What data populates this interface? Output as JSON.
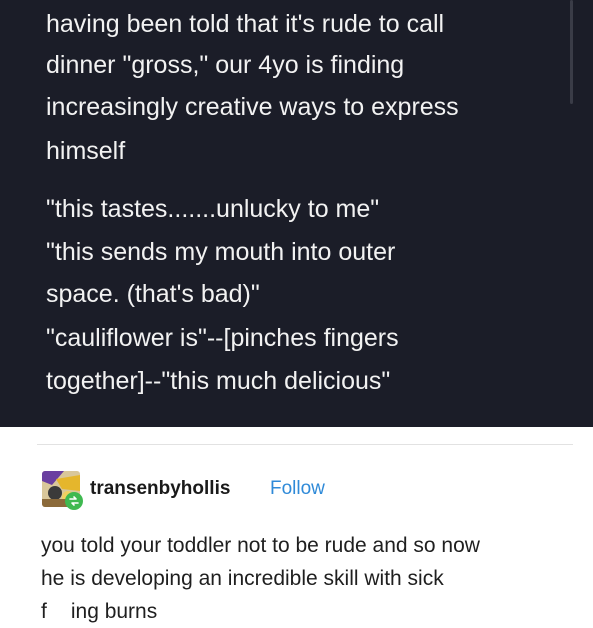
{
  "original_post": {
    "lines": [
      "having been told that it's rude to call",
      "dinner \"gross,\" our 4yo is finding",
      "increasingly creative ways to express",
      "himself",
      "\"this tastes.......unlucky to me\"",
      "\"this sends my mouth into outer",
      "space. (that's bad)\"",
      "\"cauliflower is\"--[pinches fingers",
      "together]--\"this much delicious\""
    ]
  },
  "reblog": {
    "username": "transenbyhollis",
    "follow_label": "Follow",
    "avatar_icon": "avatar-image",
    "badge_icon": "reblog-icon",
    "lines": [
      "you told your toddler not to be rude and so now",
      "he is developing an incredible skill with sick"
    ],
    "last_line_start": "f",
    "last_line_end": "ing burns"
  },
  "colors": {
    "dark_bg": "#1b1d28",
    "dark_text": "#f2f2f2",
    "follow": "#2f8ad8",
    "badge": "#3fb950"
  }
}
